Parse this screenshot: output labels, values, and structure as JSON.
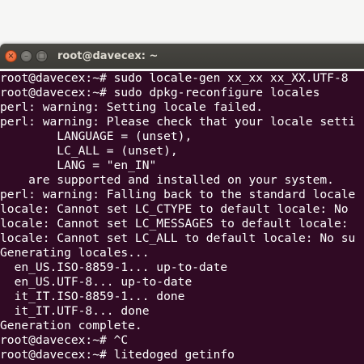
{
  "window": {
    "title": "root@davecex: ~",
    "controls": {
      "close_glyph": "×",
      "minimize_glyph": "–",
      "maximize_glyph": "□"
    }
  },
  "terminal": {
    "background": "#300a24",
    "foreground": "#ffffff",
    "lines": [
      "root@davecex:~# sudo locale-gen xx_xx xx_XX.UTF-8",
      "root@davecex:~# sudo dpkg-reconfigure locales",
      "perl: warning: Setting locale failed.",
      "perl: warning: Please check that your locale setti",
      "        LANGUAGE = (unset),",
      "        LC_ALL = (unset),",
      "        LANG = \"en_IN\"",
      "    are supported and installed on your system.",
      "perl: warning: Falling back to the standard locale",
      "locale: Cannot set LC_CTYPE to default locale: No",
      "locale: Cannot set LC_MESSAGES to default locale: ",
      "locale: Cannot set LC_ALL to default locale: No su",
      "Generating locales...",
      "  en_US.ISO-8859-1... up-to-date",
      "  en_US.UTF-8... up-to-date",
      "  it_IT.ISO-8859-1... done",
      "  it_IT.UTF-8... done",
      "Generation complete.",
      "root@davecex:~# ^C",
      "root@davecex:~# litedoged getinfo"
    ]
  }
}
